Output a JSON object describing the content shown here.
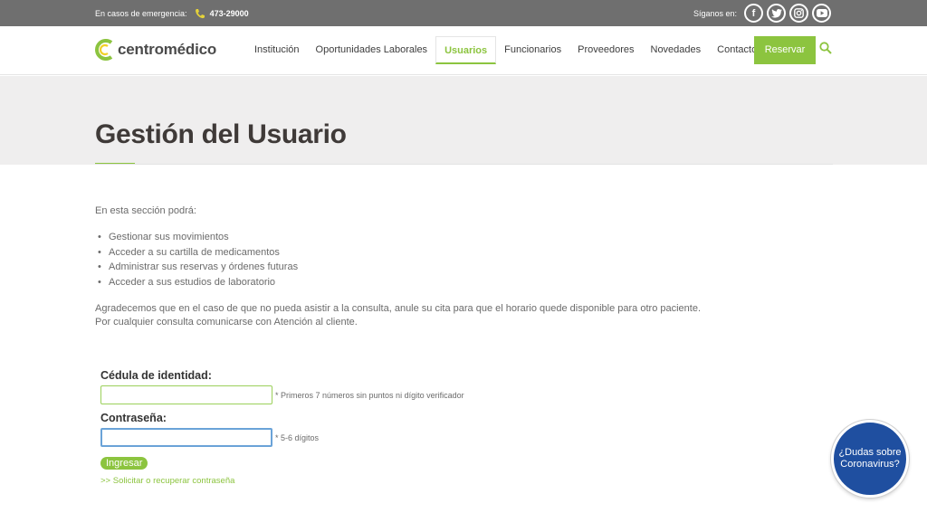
{
  "topbar": {
    "emergency_label": "En casos de emergencia:",
    "phone": "473-29000",
    "follow_label": "Síganos en:",
    "social": [
      "facebook-icon",
      "twitter-icon",
      "instagram-icon",
      "youtube-icon"
    ]
  },
  "header": {
    "logo_text": "centromédico",
    "nav": [
      {
        "label": "Institución"
      },
      {
        "label": "Oportunidades Laborales"
      },
      {
        "label": "Usuarios",
        "active": true
      },
      {
        "label": "Funcionarios"
      },
      {
        "label": "Proveedores"
      },
      {
        "label": "Novedades"
      },
      {
        "label": "Contacto"
      }
    ],
    "reserve_label": "Reservar"
  },
  "hero": {
    "title": "Gestión del Usuario"
  },
  "content": {
    "intro": "En esta sección podrá:",
    "items": [
      "Gestionar sus movimientos",
      "Acceder a su cartilla de medicamentos",
      "Administrar sus reservas y órdenes futuras",
      "Acceder a sus estudios de laboratorio"
    ],
    "note1": "Agradecemos que en el caso de que no pueda asistir a la consulta, anule su cita para que el horario quede disponible para otro paciente.",
    "note2": "Por cualquier consulta comunicarse con Atención al cliente."
  },
  "form": {
    "id_label": "Cédula de identidad:",
    "id_value": "",
    "id_hint": "* Primeros 7 números sin puntos ni dígito verificador",
    "pw_label": "Contraseña:",
    "pw_value": "",
    "pw_hint": "* 5-6 dígitos",
    "submit_label": "Ingresar",
    "recover_label": ">> Solicitar o recuperar contraseña"
  },
  "covid_badge": {
    "line1": "¿Dudas sobre",
    "line2": "Coronavirus?"
  },
  "colors": {
    "accent": "#8cc43f",
    "topbar": "#6f6f6f",
    "badge": "#1f4fa0"
  }
}
